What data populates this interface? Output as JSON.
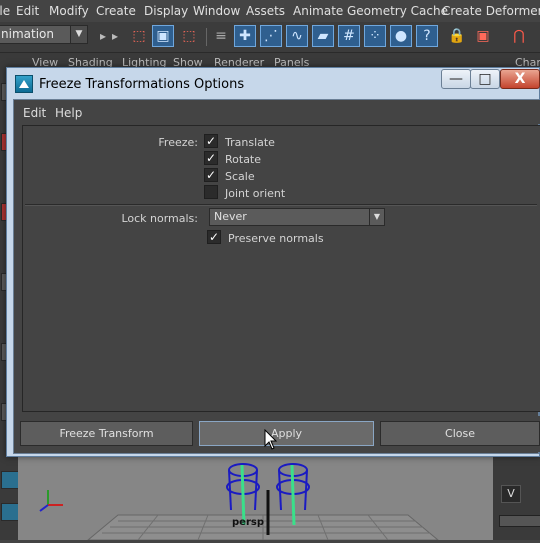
{
  "menubar": {
    "items": [
      "File",
      "Edit",
      "Modify",
      "Create",
      "Display",
      "Window",
      "Assets",
      "Animate",
      "Geometry Cache",
      "Create Deformers"
    ]
  },
  "shelf": {
    "mode": "nimation"
  },
  "panel_menu": {
    "items": [
      "View",
      "Shading",
      "Lighting",
      "Show",
      "Renderer",
      "Panels",
      "Chan"
    ]
  },
  "viewport": {
    "camera_label": "persp"
  },
  "right_panel": {
    "button_v": "V"
  },
  "dialog": {
    "title": "Freeze Transformations Options",
    "menu": {
      "edit": "Edit",
      "help": "Help"
    },
    "freeze_label": "Freeze:",
    "freeze_options": [
      {
        "label": "Translate",
        "checked": true
      },
      {
        "label": "Rotate",
        "checked": true
      },
      {
        "label": "Scale",
        "checked": true
      },
      {
        "label": "Joint orient",
        "checked": false
      }
    ],
    "lock_normals_label": "Lock normals:",
    "lock_normals_value": "Never",
    "preserve_normals": {
      "label": "Preserve normals",
      "checked": true
    },
    "buttons": {
      "freeze": "Freeze Transform",
      "apply": "Apply",
      "close": "Close"
    },
    "window_controls": {
      "minimize": "—",
      "maximize": "□",
      "close": "X"
    }
  }
}
